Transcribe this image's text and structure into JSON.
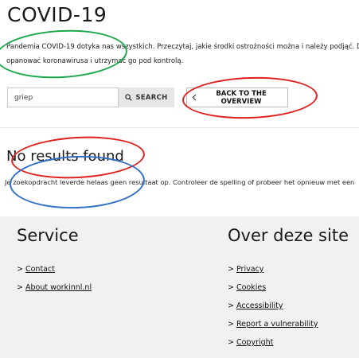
{
  "page": {
    "title": "COVID-19",
    "intro_line1": "Pandemia COVID-19 dotyka nas wszystkich. Przeczytaj, jakie środki ostrożności można i należy podjąć. Dz",
    "intro_line2": "opanować koronawirusa i utrzymać go pod kontrolą."
  },
  "search": {
    "value": "griep",
    "button_label": "SEARCH",
    "back_label": "BACK TO THE OVERVIEW"
  },
  "results": {
    "heading": "No results found",
    "message": "Je zoekopdracht leverde helaas geen resultaat op. Controleer de spelling of probeer het opnieuw met een"
  },
  "footer": {
    "service": {
      "heading": "Service",
      "links": [
        "Contact",
        "About workinnl.nl"
      ]
    },
    "about": {
      "heading": "Over deze site",
      "links": [
        "Privacy",
        "Cookies",
        "Accessibility",
        "Report a vulnerability",
        "Copyright"
      ]
    }
  },
  "icons": {
    "search": "magnifier-icon",
    "back": "chevron-left-icon"
  },
  "annotation_colors": {
    "green": "#1aa84a",
    "red": "#e0201c",
    "blue": "#2f6fc6"
  }
}
